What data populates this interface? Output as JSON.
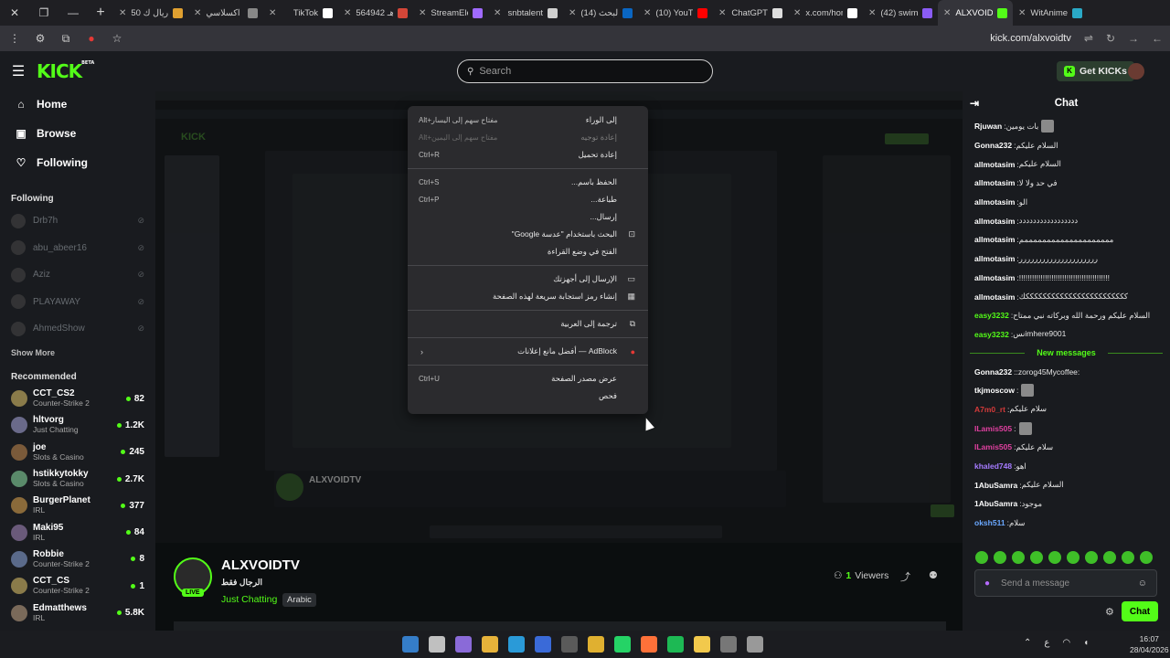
{
  "browser": {
    "tabs": [
      {
        "title": "50 ريال ك",
        "color": "#e0a030"
      },
      {
        "title": "اكسلاسي |",
        "color": "#888888"
      },
      {
        "title": "TikTok",
        "color": "#ffffff"
      },
      {
        "title": "564942 هـ",
        "color": "#d44638"
      },
      {
        "title": "StreamEle",
        "color": "#a06aff"
      },
      {
        "title": "snbtalent",
        "color": "#cfcfcf"
      },
      {
        "title": "(14) البحث",
        "color": "#0a66c2"
      },
      {
        "title": "(10) YouTu",
        "color": "#ff0000"
      },
      {
        "title": "ChatGPT",
        "color": "#dddddd"
      },
      {
        "title": "x.com/hon",
        "color": "#ffffff"
      },
      {
        "title": "(42) swimy",
        "color": "#8a5cf5"
      },
      {
        "title": "ALXVOIDT",
        "color": "#53fc18"
      },
      {
        "title": "WitAnime",
        "color": "#2aa9c6"
      }
    ],
    "url": "kick.com/alxvoidtv"
  },
  "header": {
    "logo": "KICK",
    "logo_badge": "BETA",
    "search_placeholder": "Search",
    "get_kicks": "Get KICKs"
  },
  "sidebar": {
    "nav": [
      {
        "label": "Home",
        "icon": "home-icon",
        "glyph": "⌂"
      },
      {
        "label": "Browse",
        "icon": "browse-icon",
        "glyph": "▣"
      },
      {
        "label": "Following",
        "icon": "heart-icon",
        "glyph": "♡"
      }
    ],
    "following_title": "Following",
    "following": [
      "Drb7h",
      "abu_abeer16",
      "Aziz",
      "PLAYAWAY",
      "AhmedShow"
    ],
    "show_more": "Show More",
    "recommended_title": "Recommended",
    "recommended": [
      {
        "name": "CCT_CS2",
        "category": "Counter-Strike 2",
        "viewers": "82"
      },
      {
        "name": "hltvorg",
        "category": "Just Chatting",
        "viewers": "1.2K"
      },
      {
        "name": "joe",
        "category": "Slots & Casino",
        "viewers": "245"
      },
      {
        "name": "hstikkytokky",
        "category": "Slots & Casino",
        "viewers": "2.7K"
      },
      {
        "name": "BurgerPlanet",
        "category": "IRL",
        "viewers": "377"
      },
      {
        "name": "Maki95",
        "category": "IRL",
        "viewers": "84"
      },
      {
        "name": "Robbie",
        "category": "Counter-Strike 2",
        "viewers": "8"
      },
      {
        "name": "CCT_CS",
        "category": "Counter-Strike 2",
        "viewers": "1"
      },
      {
        "name": "Edmatthews",
        "category": "IRL",
        "viewers": "5.8K"
      }
    ]
  },
  "stream": {
    "name": "ALXVOIDTV",
    "title": "الرجال فقط",
    "category": "Just Chatting",
    "tag": "Arabic",
    "live": "LIVE",
    "viewers": "1",
    "viewers_label": "Viewers",
    "nested_name": "ALXVOIDTV"
  },
  "context_menu": [
    {
      "label": "إلى الوراء",
      "shortcut": "Alt+مفتاح سهم إلى اليسار",
      "disabled": false
    },
    {
      "label": "إعادة توجيه",
      "shortcut": "Alt+مفتاح سهم إلى اليمين",
      "disabled": true
    },
    {
      "label": "إعادة تحميل",
      "shortcut": "Ctrl+R",
      "disabled": false
    },
    {
      "sep": true
    },
    {
      "label": "الحفظ باسم...",
      "shortcut": "Ctrl+S",
      "disabled": false
    },
    {
      "label": "طباعة...",
      "shortcut": "Ctrl+P",
      "disabled": false
    },
    {
      "label": "إرسال...",
      "shortcut": "",
      "disabled": false
    },
    {
      "label": "البحث باستخدام \"عدسة Google\"",
      "shortcut": "",
      "disabled": false,
      "icon": "lens-icon",
      "glyph": "⊡"
    },
    {
      "label": "الفتح في وضع القراءة",
      "shortcut": "",
      "disabled": false
    },
    {
      "sep": true
    },
    {
      "label": "الإرسال إلى أجهزتك",
      "shortcut": "",
      "disabled": false,
      "icon": "devices-icon",
      "glyph": "▭"
    },
    {
      "label": "إنشاء رمز استجابة سريعة لهذه الصفحة",
      "shortcut": "",
      "disabled": false,
      "icon": "qr-icon",
      "glyph": "▦"
    },
    {
      "sep": true
    },
    {
      "label": "ترجمة إلى العربية",
      "shortcut": "",
      "disabled": false,
      "icon": "translate-icon",
      "glyph": "⧉"
    },
    {
      "sep": true
    },
    {
      "label": "AdBlock — أفضل مانع إعلانات",
      "shortcut": "",
      "disabled": false,
      "icon": "adblock-icon",
      "glyph": "●",
      "submenu": true
    },
    {
      "sep": true
    },
    {
      "label": "عرض مصدر الصفحة",
      "shortcut": "Ctrl+U",
      "disabled": false
    },
    {
      "label": "فحص",
      "shortcut": "",
      "disabled": false
    }
  ],
  "chat": {
    "title": "Chat",
    "new_messages": "New messages",
    "before": [
      {
        "user": "Rjuwan",
        "text": "بات يومين",
        "color": "#ffffff",
        "emote": true
      },
      {
        "user": "Gonna232",
        "text": "السلام عليكم",
        "color": "#ffffff"
      },
      {
        "user": "allmotasim",
        "text": "السلام عليكم",
        "color": "#ffffff"
      },
      {
        "user": "allmotasim",
        "text": "في حد ولا لا",
        "color": "#ffffff"
      },
      {
        "user": "allmotasim",
        "text": "الو",
        "color": "#ffffff"
      },
      {
        "user": "allmotasim",
        "text": "ددددددددددددددددد",
        "color": "#ffffff"
      },
      {
        "user": "allmotasim",
        "text": "ممممممممممممممممممممم",
        "color": "#ffffff"
      },
      {
        "user": "allmotasim",
        "text": "ررررررررررررررررررررر",
        "color": "#ffffff"
      },
      {
        "user": "allmotasim",
        "text": "!!!!!!!!!!!!!!!!!!!!!!!!!!!!!!!!!!!!!!!!!!",
        "color": "#ffffff"
      },
      {
        "user": "allmotasim",
        "text": "ككككككككككككككككككككككككك",
        "color": "#ffffff"
      },
      {
        "user": "easy3232",
        "text": "السلام عليكم ورحمة الله وبركاته نبي ممتاح",
        "color": "#53fc18"
      },
      {
        "user": "easy3232",
        "text": "نسimhere9001",
        "color": "#53fc18"
      }
    ],
    "after": [
      {
        "user": "Gonna232",
        "text": ":zorog45Mycoffee:",
        "color": "#ffffff"
      },
      {
        "user": "tkjmoscow",
        "text": "",
        "color": "#ffffff",
        "emote": true
      },
      {
        "user": "A7m0_rt",
        "text": "سلام عليكم",
        "color": "#d43a3a"
      },
      {
        "user": "ILamis505",
        "text": "",
        "color": "#e040a0",
        "emote": true
      },
      {
        "user": "ILamis505",
        "text": "سلام عليكم",
        "color": "#e040a0"
      },
      {
        "user": "khaled748",
        "text": "اهو",
        "color": "#a57bff"
      },
      {
        "user": "1AbuSamra",
        "text": "السلام عليكم",
        "color": "#ffffff"
      },
      {
        "user": "1AbuSamra",
        "text": "موجود",
        "color": "#ffffff"
      },
      {
        "user": "oksh511",
        "text": "سلام",
        "color": "#6aa8ff"
      }
    ],
    "input_placeholder": "Send a message",
    "send": "Chat"
  },
  "taskbar": {
    "time": "16:07",
    "date": "28/04/2026",
    "lang": "ع"
  }
}
